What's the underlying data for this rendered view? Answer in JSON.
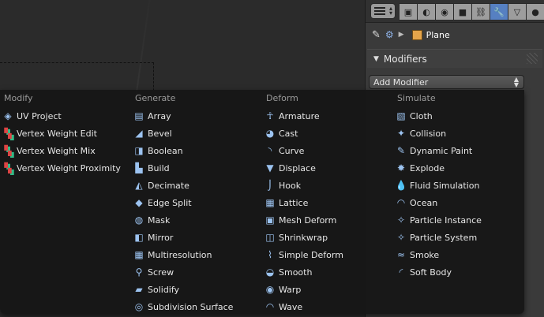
{
  "viewport": {},
  "properties": {
    "editor_type_icon": "editor-type-icon",
    "context_tabs": [
      {
        "icon": "render-icon",
        "glyph": "▣",
        "active": false
      },
      {
        "icon": "scene-icon",
        "glyph": "◐",
        "active": false
      },
      {
        "icon": "world-icon",
        "glyph": "◉",
        "active": false
      },
      {
        "icon": "object-icon",
        "glyph": "■",
        "active": false
      },
      {
        "icon": "constraints-icon",
        "glyph": "⛓",
        "active": false
      },
      {
        "icon": "modifiers-wrench-icon",
        "glyph": "🔧",
        "active": true
      },
      {
        "icon": "data-icon",
        "glyph": "▽",
        "active": false
      },
      {
        "icon": "material-icon",
        "glyph": "●",
        "active": false
      }
    ],
    "breadcrumb": {
      "object_name": "Plane"
    },
    "panel_title": "Modifiers",
    "add_modifier_label": "Add Modifier"
  },
  "menu": {
    "columns": [
      {
        "title": "Modify",
        "items": [
          {
            "label": "UV Project",
            "icon": "uv-project-icon",
            "glyph": "◈"
          },
          {
            "label": "Vertex Weight Edit",
            "icon": "vertex-weight-icon",
            "glyph": "▚"
          },
          {
            "label": "Vertex Weight Mix",
            "icon": "vertex-weight-icon",
            "glyph": "▚"
          },
          {
            "label": "Vertex Weight Proximity",
            "icon": "vertex-weight-icon",
            "glyph": "▚"
          }
        ]
      },
      {
        "title": "Generate",
        "items": [
          {
            "label": "Array",
            "icon": "array-icon",
            "glyph": "▤"
          },
          {
            "label": "Bevel",
            "icon": "bevel-icon",
            "glyph": "◢"
          },
          {
            "label": "Boolean",
            "icon": "boolean-icon",
            "glyph": "◨"
          },
          {
            "label": "Build",
            "icon": "build-icon",
            "glyph": "▙"
          },
          {
            "label": "Decimate",
            "icon": "decimate-icon",
            "glyph": "◭"
          },
          {
            "label": "Edge Split",
            "icon": "edge-split-icon",
            "glyph": "◆"
          },
          {
            "label": "Mask",
            "icon": "mask-icon",
            "glyph": "◍"
          },
          {
            "label": "Mirror",
            "icon": "mirror-icon",
            "glyph": "◧"
          },
          {
            "label": "Multiresolution",
            "icon": "multiresolution-icon",
            "glyph": "▦"
          },
          {
            "label": "Screw",
            "icon": "screw-icon",
            "glyph": "⚲"
          },
          {
            "label": "Solidify",
            "icon": "solidify-icon",
            "glyph": "▰"
          },
          {
            "label": "Subdivision Surface",
            "icon": "subsurf-icon",
            "glyph": "◎"
          }
        ]
      },
      {
        "title": "Deform",
        "items": [
          {
            "label": "Armature",
            "icon": "armature-icon",
            "glyph": "☥"
          },
          {
            "label": "Cast",
            "icon": "cast-icon",
            "glyph": "◕"
          },
          {
            "label": "Curve",
            "icon": "curve-icon",
            "glyph": "◝"
          },
          {
            "label": "Displace",
            "icon": "displace-icon",
            "glyph": "▼"
          },
          {
            "label": "Hook",
            "icon": "hook-icon",
            "glyph": "⌡"
          },
          {
            "label": "Lattice",
            "icon": "lattice-icon",
            "glyph": "▦"
          },
          {
            "label": "Mesh Deform",
            "icon": "mesh-deform-icon",
            "glyph": "▣"
          },
          {
            "label": "Shrinkwrap",
            "icon": "shrinkwrap-icon",
            "glyph": "◫"
          },
          {
            "label": "Simple Deform",
            "icon": "simple-deform-icon",
            "glyph": "⌇"
          },
          {
            "label": "Smooth",
            "icon": "smooth-icon",
            "glyph": "◒"
          },
          {
            "label": "Warp",
            "icon": "warp-icon",
            "glyph": "◉"
          },
          {
            "label": "Wave",
            "icon": "wave-icon",
            "glyph": "◠"
          }
        ]
      },
      {
        "title": "Simulate",
        "items": [
          {
            "label": "Cloth",
            "icon": "cloth-icon",
            "glyph": "▧"
          },
          {
            "label": "Collision",
            "icon": "collision-icon",
            "glyph": "✦"
          },
          {
            "label": "Dynamic Paint",
            "icon": "dynamic-paint-icon",
            "glyph": "✎"
          },
          {
            "label": "Explode",
            "icon": "explode-icon",
            "glyph": "✸"
          },
          {
            "label": "Fluid Simulation",
            "icon": "fluid-icon",
            "glyph": "💧"
          },
          {
            "label": "Ocean",
            "icon": "ocean-icon",
            "glyph": "◠"
          },
          {
            "label": "Particle Instance",
            "icon": "particle-instance-icon",
            "glyph": "✧"
          },
          {
            "label": "Particle System",
            "icon": "particle-system-icon",
            "glyph": "✧"
          },
          {
            "label": "Smoke",
            "icon": "smoke-icon",
            "glyph": "≈"
          },
          {
            "label": "Soft Body",
            "icon": "soft-body-icon",
            "glyph": "◜"
          }
        ]
      }
    ]
  }
}
